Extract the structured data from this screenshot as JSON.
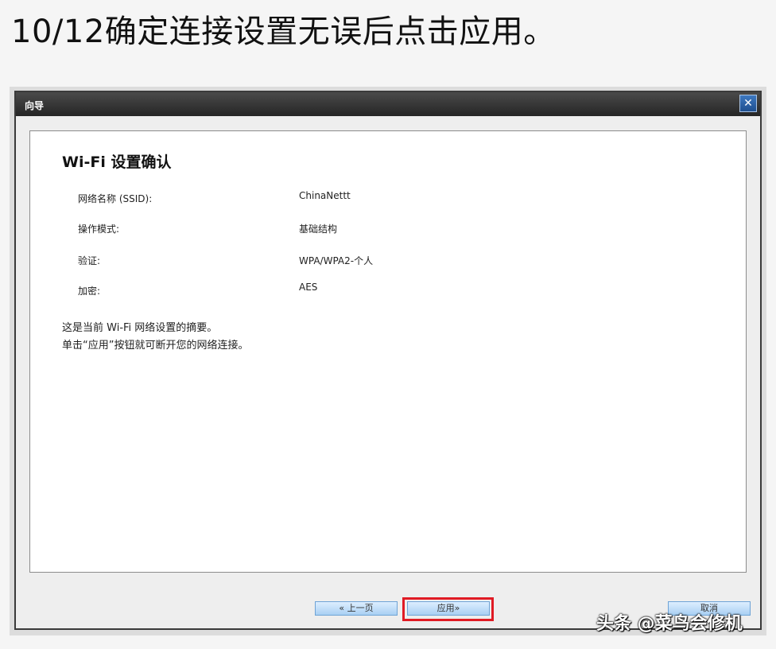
{
  "caption": "10/12确定连接设置无误后点击应用。",
  "window": {
    "title": "向导",
    "close_glyph": "✕"
  },
  "panel": {
    "heading": "Wi-Fi 设置确认",
    "settings": [
      {
        "label": "网络名称 (SSID):",
        "value": "ChinaNettt"
      },
      {
        "label": "操作模式:",
        "value": "基础结构"
      },
      {
        "label": "验证:",
        "value": "WPA/WPA2-个人"
      },
      {
        "label": "加密:",
        "value": "AES"
      }
    ],
    "summary": [
      "这是当前 Wi-Fi 网络设置的摘要。",
      "单击“应用”按钮就可断开您的网络连接。"
    ]
  },
  "buttons": {
    "prev": "« 上一页",
    "apply": "应用»",
    "cancel": "取消"
  },
  "highlight_color": "#e01b24",
  "watermark": "头条 @菜鸟会修机"
}
